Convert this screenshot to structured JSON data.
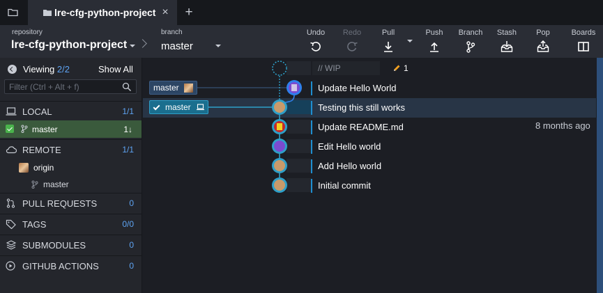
{
  "tabs": [
    {
      "title": "lre-cfg-python-project",
      "close": "×"
    }
  ],
  "new_tab": "+",
  "toolbar": {
    "repository_label": "repository",
    "repository_name": "lre-cfg-python-project",
    "branch_label": "branch",
    "branch_name": "master",
    "buttons": {
      "undo": "Undo",
      "redo": "Redo",
      "pull": "Pull",
      "push": "Push",
      "branch": "Branch",
      "stash": "Stash",
      "pop": "Pop",
      "boards": "Boards"
    }
  },
  "sidebar": {
    "viewing_label": "Viewing",
    "viewing_count": "2/2",
    "show_all": "Show All",
    "filter_placeholder": "Filter (Ctrl + Alt + f)",
    "local": {
      "label": "LOCAL",
      "count": "1/1"
    },
    "local_branch": {
      "name": "master",
      "status": "1↓"
    },
    "remote": {
      "label": "REMOTE",
      "count": "1/1"
    },
    "remote_origin": "origin",
    "remote_branch": "master",
    "pull_requests": {
      "label": "PULL REQUESTS",
      "count": "0"
    },
    "tags": {
      "label": "TAGS",
      "count": "0/0"
    },
    "submodules": {
      "label": "SUBMODULES",
      "count": "0"
    },
    "github_actions": {
      "label": "GITHUB ACTIONS",
      "count": "0"
    }
  },
  "graph": {
    "wip_placeholder": "// WIP",
    "wip_changes": "1",
    "remote_ref": "master",
    "local_ref": "master",
    "commits": [
      {
        "message": "Update Hello World",
        "time": ""
      },
      {
        "message": "Testing this still works",
        "time": ""
      },
      {
        "message": "Update README.md",
        "time": "8 months ago"
      },
      {
        "message": "Edit Hello world",
        "time": ""
      },
      {
        "message": "Add Hello world",
        "time": ""
      },
      {
        "message": "Initial commit",
        "time": ""
      }
    ]
  },
  "colors": {
    "accent": "#5ea4f4",
    "graph_line": "#2ea0c9",
    "selected_row": "#283546",
    "local_highlight": "#3a5a3c"
  }
}
